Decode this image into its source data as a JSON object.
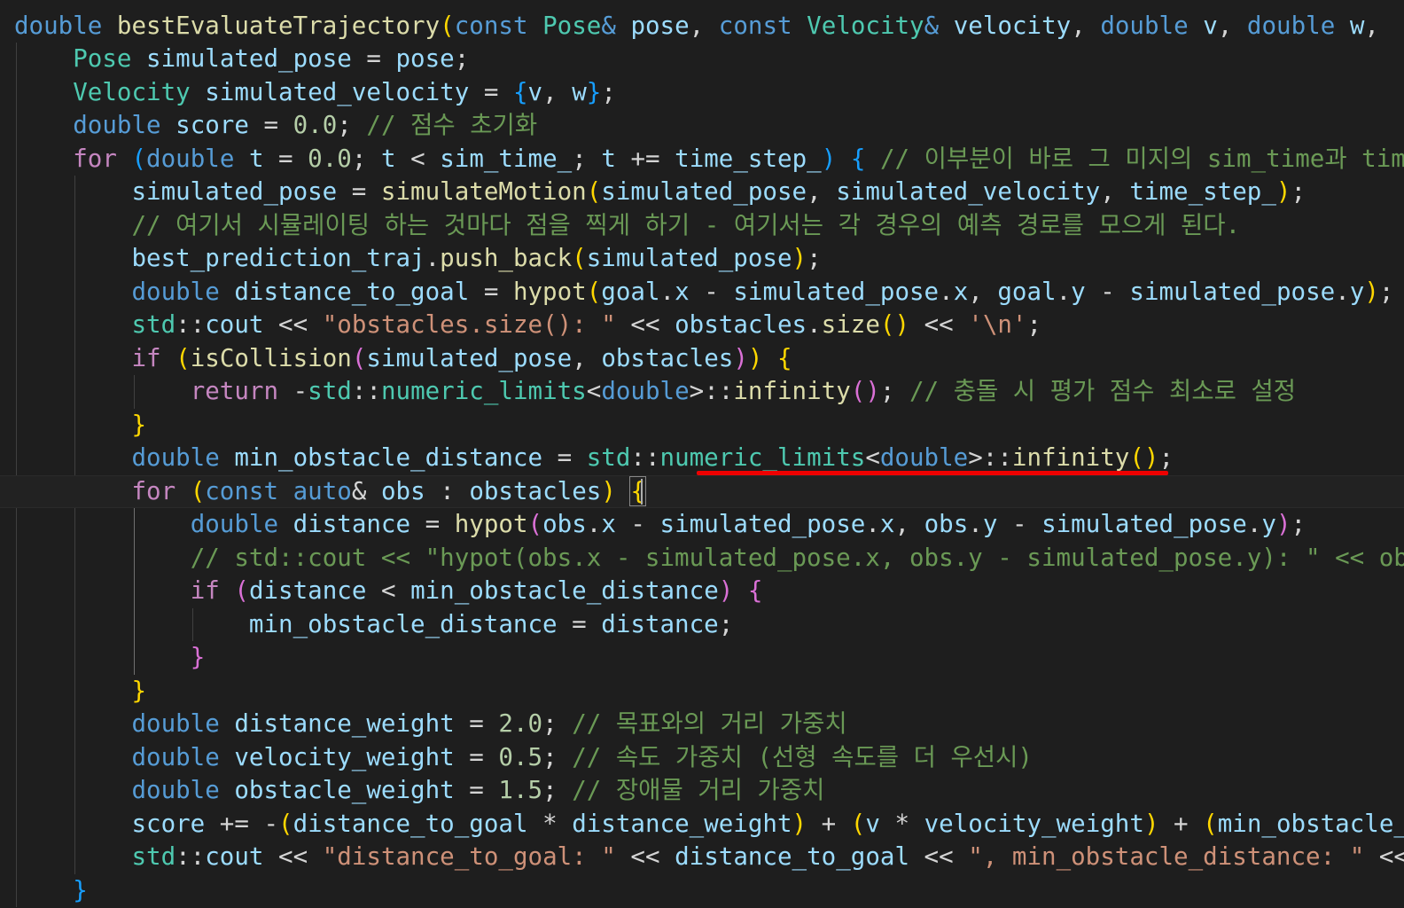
{
  "editor": {
    "language": "cpp",
    "current_line_index": 14,
    "lines": [
      [
        [
          "kw",
          "double"
        ],
        [
          "op",
          " "
        ],
        [
          "fn",
          "bestEvaluateTrajectory"
        ],
        [
          "b1",
          "("
        ],
        [
          "kw",
          "const"
        ],
        [
          "op",
          " "
        ],
        [
          "ty",
          "Pose"
        ],
        [
          "kw",
          "&"
        ],
        [
          "op",
          " "
        ],
        [
          "vr",
          "pose"
        ],
        [
          "op",
          ", "
        ],
        [
          "kw",
          "const"
        ],
        [
          "op",
          " "
        ],
        [
          "ty",
          "Velocity"
        ],
        [
          "kw",
          "&"
        ],
        [
          "op",
          " "
        ],
        [
          "vr",
          "velocity"
        ],
        [
          "op",
          ", "
        ],
        [
          "kw",
          "double"
        ],
        [
          "op",
          " "
        ],
        [
          "vr",
          "v"
        ],
        [
          "op",
          ", "
        ],
        [
          "kw",
          "double"
        ],
        [
          "op",
          " "
        ],
        [
          "vr",
          "w"
        ],
        [
          "op",
          ", "
        ]
      ],
      [
        [
          "op",
          "    "
        ],
        [
          "ty",
          "Pose"
        ],
        [
          "op",
          " "
        ],
        [
          "vr",
          "simulated_pose"
        ],
        [
          "op",
          " = "
        ],
        [
          "vr",
          "pose"
        ],
        [
          "op",
          ";"
        ]
      ],
      [
        [
          "op",
          "    "
        ],
        [
          "ty",
          "Velocity"
        ],
        [
          "op",
          " "
        ],
        [
          "vr",
          "simulated_velocity"
        ],
        [
          "op",
          " = "
        ],
        [
          "b3",
          "{"
        ],
        [
          "vr",
          "v"
        ],
        [
          "op",
          ", "
        ],
        [
          "vr",
          "w"
        ],
        [
          "b3",
          "}"
        ],
        [
          "op",
          ";"
        ]
      ],
      [
        [
          "op",
          "    "
        ],
        [
          "kw",
          "double"
        ],
        [
          "op",
          " "
        ],
        [
          "vr",
          "score"
        ],
        [
          "op",
          " = "
        ],
        [
          "nm",
          "0.0"
        ],
        [
          "op",
          "; "
        ],
        [
          "cm",
          "// 점수 초기화"
        ]
      ],
      [
        [
          "op",
          "    "
        ],
        [
          "ctl",
          "for"
        ],
        [
          "op",
          " "
        ],
        [
          "b3",
          "("
        ],
        [
          "kw",
          "double"
        ],
        [
          "op",
          " "
        ],
        [
          "vr",
          "t"
        ],
        [
          "op",
          " = "
        ],
        [
          "nm",
          "0.0"
        ],
        [
          "op",
          "; "
        ],
        [
          "vr",
          "t"
        ],
        [
          "op",
          " < "
        ],
        [
          "vr",
          "sim_time_"
        ],
        [
          "op",
          "; "
        ],
        [
          "vr",
          "t"
        ],
        [
          "op",
          " += "
        ],
        [
          "vr",
          "time_step_"
        ],
        [
          "b3",
          ")"
        ],
        [
          "op",
          " "
        ],
        [
          "b3",
          "{"
        ],
        [
          "op",
          " "
        ],
        [
          "cm",
          "// 이부분이 바로 그 미지의 sim_time과 time_step"
        ]
      ],
      [
        [
          "op",
          "        "
        ],
        [
          "vr",
          "simulated_pose"
        ],
        [
          "op",
          " = "
        ],
        [
          "fn",
          "simulateMotion"
        ],
        [
          "b1",
          "("
        ],
        [
          "vr",
          "simulated_pose"
        ],
        [
          "op",
          ", "
        ],
        [
          "vr",
          "simulated_velocity"
        ],
        [
          "op",
          ", "
        ],
        [
          "vr",
          "time_step_"
        ],
        [
          "b1",
          ")"
        ],
        [
          "op",
          ";"
        ]
      ],
      [
        [
          "op",
          "        "
        ],
        [
          "cm",
          "// 여기서 시뮬레이팅 하는 것마다 점을 찍게 하기 - 여기서는 각 경우의 예측 경로를 모으게 된다."
        ]
      ],
      [
        [
          "op",
          "        "
        ],
        [
          "vr",
          "best_prediction_traj"
        ],
        [
          "op",
          "."
        ],
        [
          "fn",
          "push_back"
        ],
        [
          "b1",
          "("
        ],
        [
          "vr",
          "simulated_pose"
        ],
        [
          "b1",
          ")"
        ],
        [
          "op",
          ";"
        ]
      ],
      [
        [
          "op",
          "        "
        ],
        [
          "kw",
          "double"
        ],
        [
          "op",
          " "
        ],
        [
          "vr",
          "distance_to_goal"
        ],
        [
          "op",
          " = "
        ],
        [
          "fn",
          "hypot"
        ],
        [
          "b1",
          "("
        ],
        [
          "vr",
          "goal"
        ],
        [
          "op",
          "."
        ],
        [
          "vr",
          "x"
        ],
        [
          "op",
          " - "
        ],
        [
          "vr",
          "simulated_pose"
        ],
        [
          "op",
          "."
        ],
        [
          "vr",
          "x"
        ],
        [
          "op",
          ", "
        ],
        [
          "vr",
          "goal"
        ],
        [
          "op",
          "."
        ],
        [
          "vr",
          "y"
        ],
        [
          "op",
          " - "
        ],
        [
          "vr",
          "simulated_pose"
        ],
        [
          "op",
          "."
        ],
        [
          "vr",
          "y"
        ],
        [
          "b1",
          ")"
        ],
        [
          "op",
          ";"
        ]
      ],
      [
        [
          "op",
          "        "
        ],
        [
          "ty",
          "std"
        ],
        [
          "op",
          "::"
        ],
        [
          "vr",
          "cout"
        ],
        [
          "op",
          " << "
        ],
        [
          "st",
          "\"obstacles.size(): \""
        ],
        [
          "op",
          " << "
        ],
        [
          "vr",
          "obstacles"
        ],
        [
          "op",
          "."
        ],
        [
          "fn",
          "size"
        ],
        [
          "b1",
          "()"
        ],
        [
          "op",
          " << "
        ],
        [
          "st",
          "'\\n'"
        ],
        [
          "op",
          ";"
        ]
      ],
      [
        [
          "op",
          "        "
        ],
        [
          "ctl",
          "if"
        ],
        [
          "op",
          " "
        ],
        [
          "b1",
          "("
        ],
        [
          "fn",
          "isCollision"
        ],
        [
          "b2",
          "("
        ],
        [
          "vr",
          "simulated_pose"
        ],
        [
          "op",
          ", "
        ],
        [
          "vr",
          "obstacles"
        ],
        [
          "b2",
          ")"
        ],
        [
          "b1",
          ")"
        ],
        [
          "op",
          " "
        ],
        [
          "b1",
          "{"
        ]
      ],
      [
        [
          "op",
          "            "
        ],
        [
          "ctl",
          "return"
        ],
        [
          "op",
          " -"
        ],
        [
          "ty",
          "std"
        ],
        [
          "op",
          "::"
        ],
        [
          "ty",
          "numeric_limits"
        ],
        [
          "op",
          "<"
        ],
        [
          "kw",
          "double"
        ],
        [
          "op",
          ">::"
        ],
        [
          "fn",
          "infinity"
        ],
        [
          "b2",
          "()"
        ],
        [
          "op",
          "; "
        ],
        [
          "cm",
          "// 충돌 시 평가 점수 최소로 설정"
        ]
      ],
      [
        [
          "op",
          "        "
        ],
        [
          "b1",
          "}"
        ]
      ],
      [
        [
          "op",
          "        "
        ],
        [
          "kw",
          "double"
        ],
        [
          "op",
          " "
        ],
        [
          "vr",
          "min_obstacle_distance"
        ],
        [
          "op",
          " = "
        ],
        [
          "ty",
          "std"
        ],
        [
          "op",
          "::"
        ],
        [
          "ty",
          "numeric_limits"
        ],
        [
          "op",
          "<"
        ],
        [
          "kw",
          "double"
        ],
        [
          "op",
          ">::"
        ],
        [
          "fn",
          "infinity"
        ],
        [
          "b1",
          "()"
        ],
        [
          "op",
          ";"
        ]
      ],
      [
        [
          "op",
          "        "
        ],
        [
          "ctl",
          "for"
        ],
        [
          "op",
          " "
        ],
        [
          "b1",
          "("
        ],
        [
          "kw",
          "const"
        ],
        [
          "op",
          " "
        ],
        [
          "kw",
          "auto"
        ],
        [
          "op",
          "& "
        ],
        [
          "vr",
          "obs"
        ],
        [
          "op",
          " : "
        ],
        [
          "vr",
          "obstacles"
        ],
        [
          "b1",
          ")"
        ],
        [
          "op",
          " "
        ],
        [
          "b1",
          "{"
        ]
      ],
      [
        [
          "op",
          "            "
        ],
        [
          "kw",
          "double"
        ],
        [
          "op",
          " "
        ],
        [
          "vr",
          "distance"
        ],
        [
          "op",
          " = "
        ],
        [
          "fn",
          "hypot"
        ],
        [
          "b2",
          "("
        ],
        [
          "vr",
          "obs"
        ],
        [
          "op",
          "."
        ],
        [
          "vr",
          "x"
        ],
        [
          "op",
          " - "
        ],
        [
          "vr",
          "simulated_pose"
        ],
        [
          "op",
          "."
        ],
        [
          "vr",
          "x"
        ],
        [
          "op",
          ", "
        ],
        [
          "vr",
          "obs"
        ],
        [
          "op",
          "."
        ],
        [
          "vr",
          "y"
        ],
        [
          "op",
          " - "
        ],
        [
          "vr",
          "simulated_pose"
        ],
        [
          "op",
          "."
        ],
        [
          "vr",
          "y"
        ],
        [
          "b2",
          ")"
        ],
        [
          "op",
          ";"
        ]
      ],
      [
        [
          "op",
          "            "
        ],
        [
          "cm",
          "// std::cout << \"hypot(obs.x - simulated_pose.x, obs.y - simulated_pose.y): \" << obs.x"
        ]
      ],
      [
        [
          "op",
          "            "
        ],
        [
          "ctl",
          "if"
        ],
        [
          "op",
          " "
        ],
        [
          "b2",
          "("
        ],
        [
          "vr",
          "distance"
        ],
        [
          "op",
          " < "
        ],
        [
          "vr",
          "min_obstacle_distance"
        ],
        [
          "b2",
          ")"
        ],
        [
          "op",
          " "
        ],
        [
          "b2",
          "{"
        ]
      ],
      [
        [
          "op",
          "                "
        ],
        [
          "vr",
          "min_obstacle_distance"
        ],
        [
          "op",
          " = "
        ],
        [
          "vr",
          "distance"
        ],
        [
          "op",
          ";"
        ]
      ],
      [
        [
          "op",
          "            "
        ],
        [
          "b2",
          "}"
        ]
      ],
      [
        [
          "op",
          "        "
        ],
        [
          "b1",
          "}"
        ]
      ],
      [
        [
          "op",
          "        "
        ],
        [
          "kw",
          "double"
        ],
        [
          "op",
          " "
        ],
        [
          "vr",
          "distance_weight"
        ],
        [
          "op",
          " = "
        ],
        [
          "nm",
          "2.0"
        ],
        [
          "op",
          "; "
        ],
        [
          "cm",
          "// 목표와의 거리 가중치"
        ]
      ],
      [
        [
          "op",
          "        "
        ],
        [
          "kw",
          "double"
        ],
        [
          "op",
          " "
        ],
        [
          "vr",
          "velocity_weight"
        ],
        [
          "op",
          " = "
        ],
        [
          "nm",
          "0.5"
        ],
        [
          "op",
          "; "
        ],
        [
          "cm",
          "// 속도 가중치 (선형 속도를 더 우선시)"
        ]
      ],
      [
        [
          "op",
          "        "
        ],
        [
          "kw",
          "double"
        ],
        [
          "op",
          " "
        ],
        [
          "vr",
          "obstacle_weight"
        ],
        [
          "op",
          " = "
        ],
        [
          "nm",
          "1.5"
        ],
        [
          "op",
          "; "
        ],
        [
          "cm",
          "// 장애물 거리 가중치"
        ]
      ],
      [
        [
          "op",
          "        "
        ],
        [
          "vr",
          "score"
        ],
        [
          "op",
          " += -"
        ],
        [
          "b1",
          "("
        ],
        [
          "vr",
          "distance_to_goal"
        ],
        [
          "op",
          " * "
        ],
        [
          "vr",
          "distance_weight"
        ],
        [
          "b1",
          ")"
        ],
        [
          "op",
          " + "
        ],
        [
          "b1",
          "("
        ],
        [
          "vr",
          "v"
        ],
        [
          "op",
          " * "
        ],
        [
          "vr",
          "velocity_weight"
        ],
        [
          "b1",
          ")"
        ],
        [
          "op",
          " + "
        ],
        [
          "b1",
          "("
        ],
        [
          "vr",
          "min_obstacle_distance"
        ],
        [
          "op",
          " * "
        ],
        [
          "vr",
          "obstacle_weight"
        ],
        [
          "b1",
          ")"
        ],
        [
          "op",
          ";"
        ]
      ],
      [
        [
          "op",
          "        "
        ],
        [
          "ty",
          "std"
        ],
        [
          "op",
          "::"
        ],
        [
          "vr",
          "cout"
        ],
        [
          "op",
          " << "
        ],
        [
          "st",
          "\"distance_to_goal: \""
        ],
        [
          "op",
          " << "
        ],
        [
          "vr",
          "distance_to_goal"
        ],
        [
          "op",
          " << "
        ],
        [
          "st",
          "\", min_obstacle_distance: \""
        ],
        [
          "op",
          " << "
        ],
        [
          "vr",
          "min_obstacle_distance"
        ],
        [
          "op",
          ";"
        ]
      ],
      [
        [
          "op",
          "    "
        ],
        [
          "b3",
          "}"
        ]
      ]
    ]
  }
}
